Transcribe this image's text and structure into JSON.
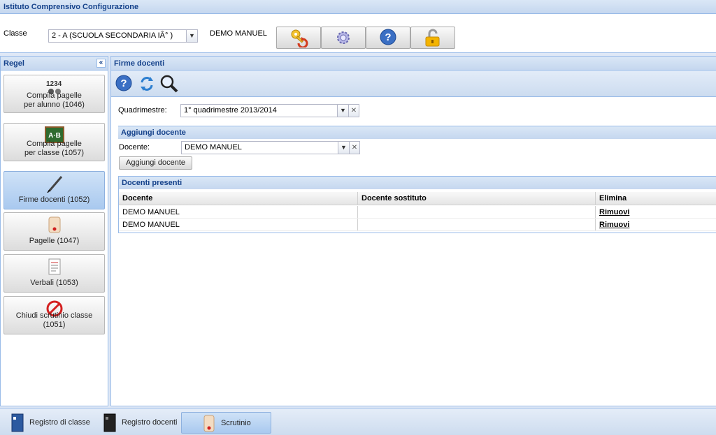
{
  "window": {
    "title": "Istituto Comprensivo Configurazione"
  },
  "topbar": {
    "classe_label": "Classe",
    "classe_value": "2 - A (SCUOLA SECONDARIA IÂ° )",
    "user_name": "DEMO MANUEL",
    "buttons": [
      {
        "name": "key-refresh-icon"
      },
      {
        "name": "gear-icon"
      },
      {
        "name": "help-icon"
      },
      {
        "name": "unlock-icon"
      }
    ]
  },
  "sidebar": {
    "title": "Regel",
    "collapse_symbol": "«",
    "items": [
      {
        "line1": "Compila pagelle",
        "line2": "per alunno (1046)",
        "icon": "numbers-icon"
      },
      {
        "line1": "Compila pagelle",
        "line2": "per classe (1057)",
        "icon": "chalkboard-icon"
      },
      {
        "line1": "Firme docenti (1052)",
        "line2": "",
        "icon": "pen-icon",
        "active": true
      },
      {
        "line1": "Pagelle (1047)",
        "line2": "",
        "icon": "scroll-icon"
      },
      {
        "line1": "Verbali (1053)",
        "line2": "",
        "icon": "document-icon"
      },
      {
        "line1": "Chiudi scrutinio classe (1051)",
        "line2": "",
        "icon": "prohibited-icon"
      }
    ]
  },
  "main": {
    "title": "Firme docenti",
    "quadrimestre_label": "Quadrimestre:",
    "quadrimestre_value": "1° quadrimestre 2013/2014",
    "aggiungi_section": "Aggiungi docente",
    "docente_label": "Docente:",
    "docente_value": "DEMO MANUEL",
    "aggiungi_button": "Aggiungi docente",
    "presenti_section": "Docenti presenti",
    "columns": [
      "Docente",
      "Docente sostituto",
      "Elimina"
    ],
    "rows": [
      {
        "docente": "DEMO MANUEL",
        "sostituto": "",
        "elimina": "Rimuovi"
      },
      {
        "docente": "DEMO MANUEL",
        "sostituto": "",
        "elimina": "Rimuovi"
      }
    ]
  },
  "taskbar": {
    "tabs": [
      {
        "label": "Registro di classe"
      },
      {
        "label": "Registro docenti"
      },
      {
        "label": "Scrutinio",
        "active": true
      }
    ]
  },
  "colors": {
    "accent": "#15428b",
    "border": "#99bbe8",
    "active": "#a9c9ef"
  }
}
